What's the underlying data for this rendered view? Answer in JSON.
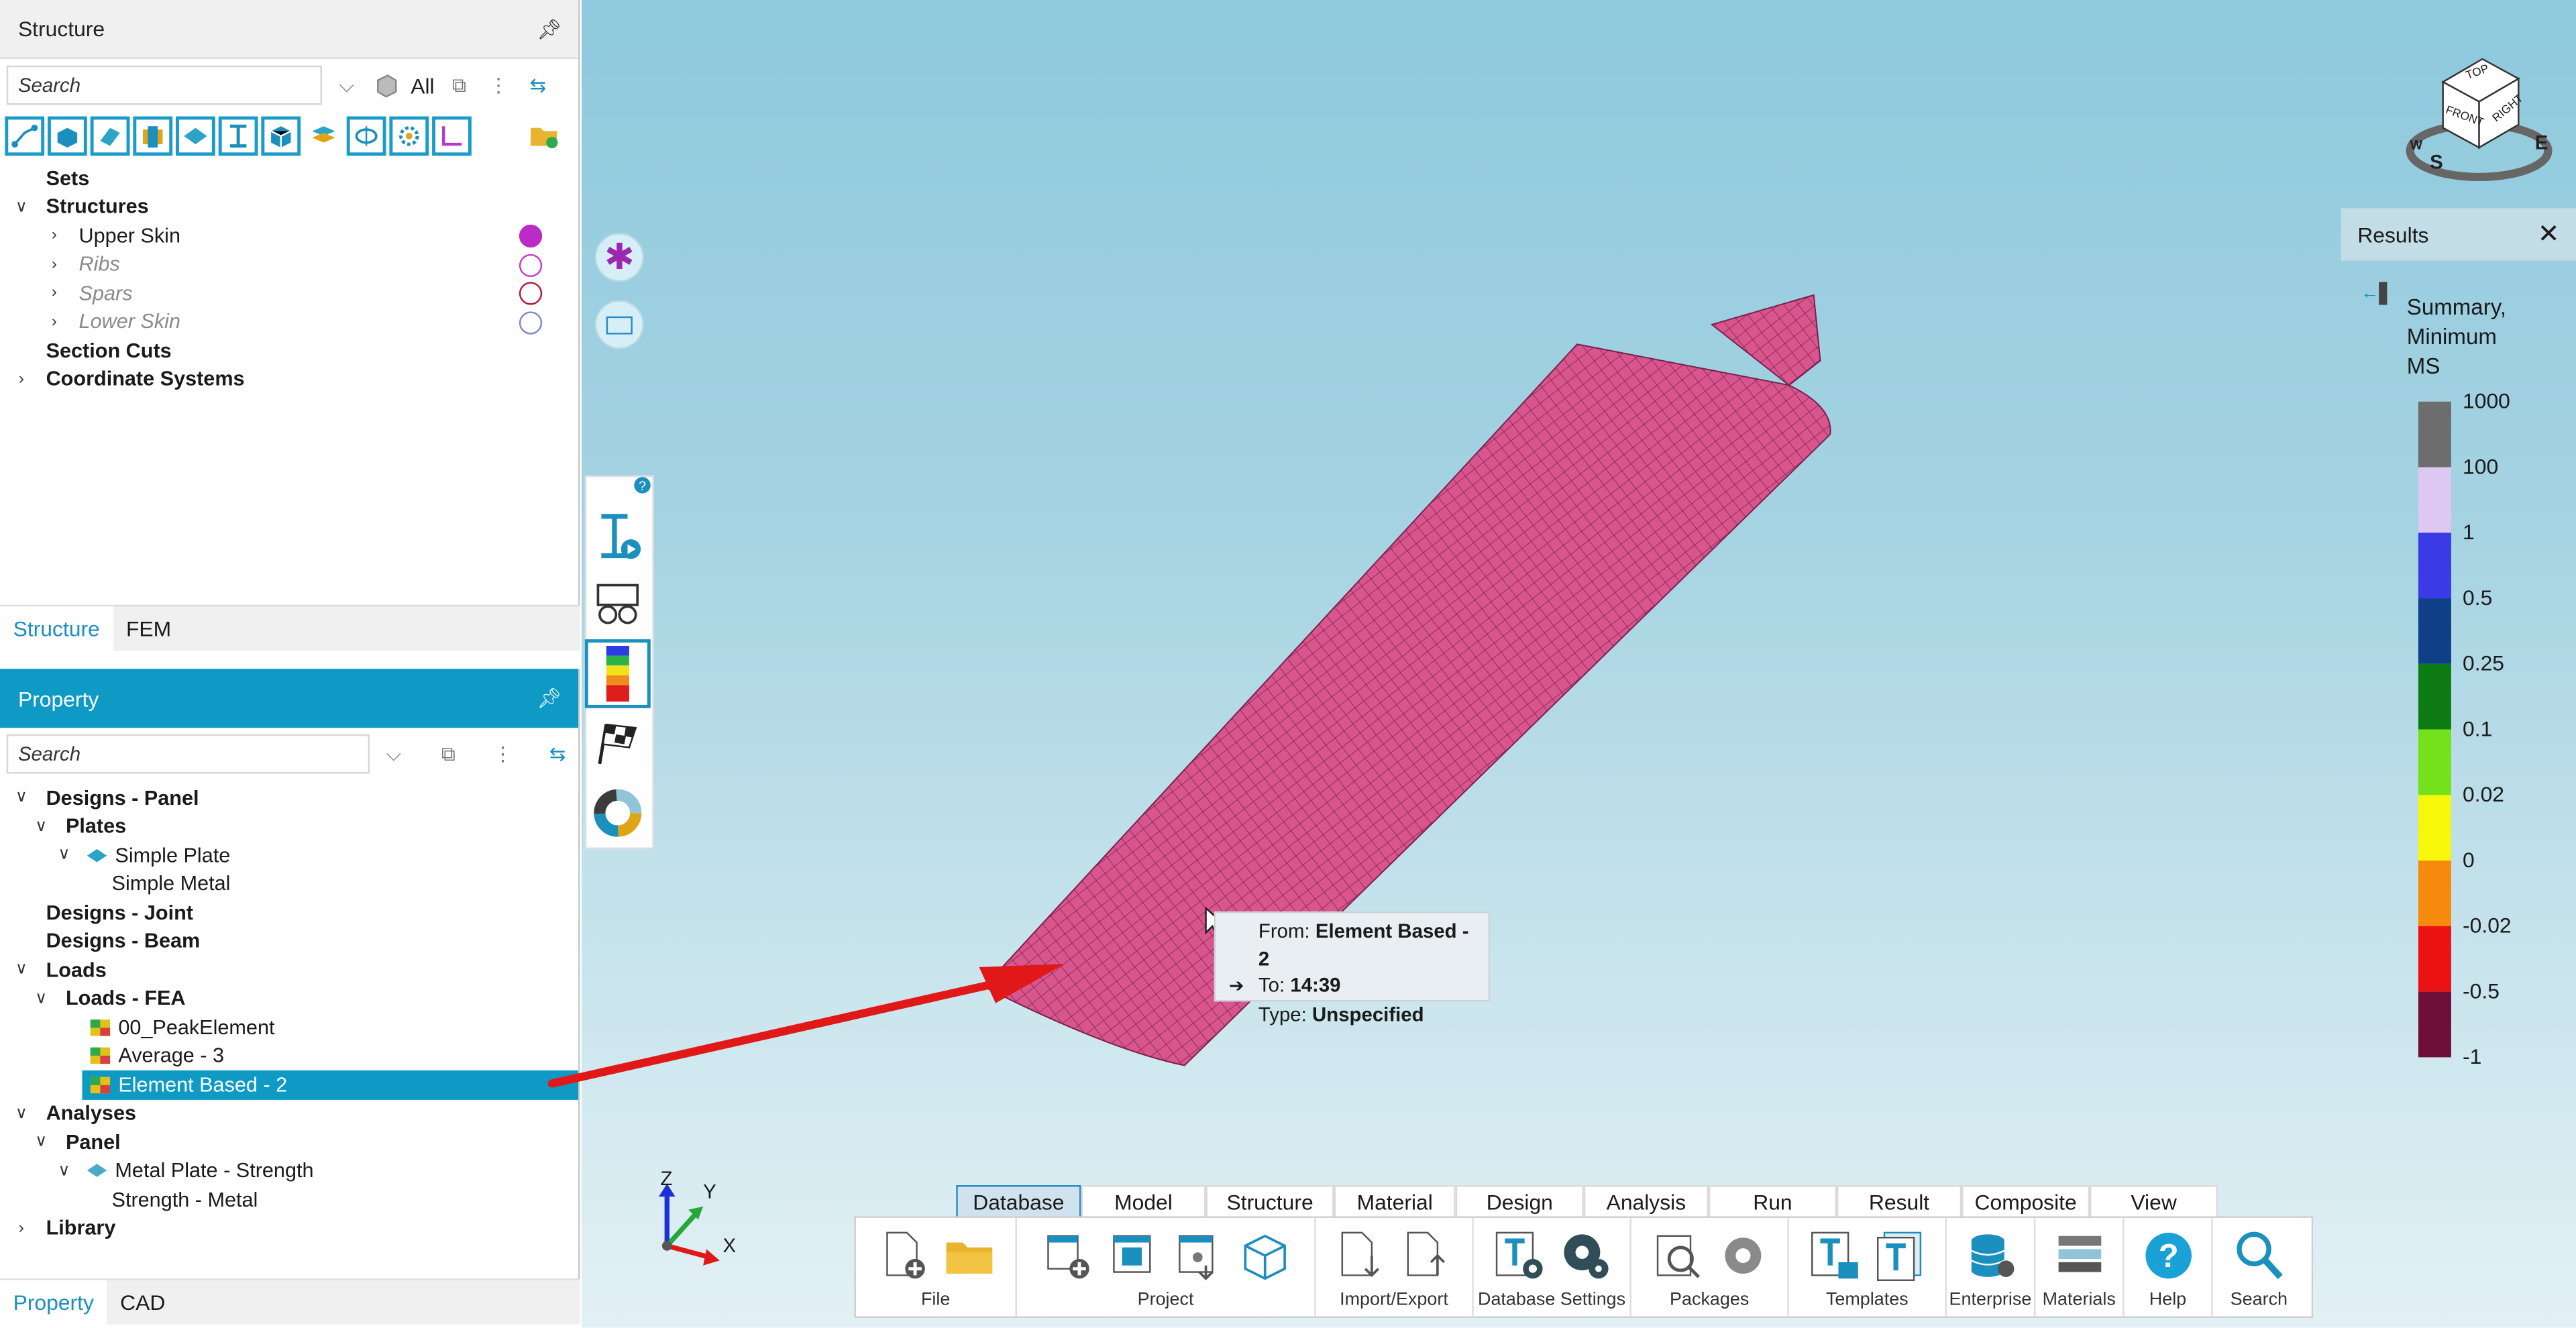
{
  "structure_panel": {
    "title": "Structure",
    "search_placeholder": "Search",
    "filter_all": "All",
    "tree": {
      "sets": "Sets",
      "structures": "Structures",
      "upper_skin": "Upper Skin",
      "ribs": "Ribs",
      "spars": "Spars",
      "lower_skin": "Lower Skin",
      "section_cuts": "Section Cuts",
      "coordinate_systems": "Coordinate Systems"
    },
    "tabs": [
      "Structure",
      "FEM"
    ]
  },
  "property_panel": {
    "title": "Property",
    "search_placeholder": "Search",
    "tree": {
      "designs_panel": "Designs - Panel",
      "plates": "Plates",
      "simple_plate": "Simple Plate",
      "simple_metal": "Simple Metal",
      "designs_joint": "Designs - Joint",
      "designs_beam": "Designs - Beam",
      "loads": "Loads",
      "loads_fea": "Loads - FEA",
      "peak_element": "00_PeakElement",
      "average_3": "Average - 3",
      "element_based_2": "Element Based - 2",
      "analyses": "Analyses",
      "panel": "Panel",
      "metal_plate_strength": "Metal Plate - Strength",
      "strength_metal": "Strength - Metal",
      "library": "Library"
    },
    "tabs": [
      "Property",
      "CAD"
    ]
  },
  "tooltip": {
    "from_label": "From:",
    "from_value": "Element Based - 2",
    "to_label": "To:",
    "to_value": "14:39",
    "type_label": "Type:",
    "type_value": "Unspecified"
  },
  "view_cube": {
    "top": "TOP",
    "front": "FRONT",
    "right": "RIGHT",
    "compass_s": "S",
    "compass_e": "E",
    "compass_w": "W"
  },
  "axes": {
    "x": "X",
    "y": "Y",
    "z": "Z"
  },
  "results": {
    "title": "Results",
    "legend_title_1": "Summary,",
    "legend_title_2": "Minimum",
    "legend_title_3": "MS",
    "labels": [
      "1000",
      "100",
      "1",
      "0.5",
      "0.25",
      "0.1",
      "0.02",
      "0",
      "-0.02",
      "-0.5",
      "-1"
    ],
    "colors": [
      "#6d6d6d",
      "#dcc8f0",
      "#3a3ae6",
      "#0f3f87",
      "#0e7a12",
      "#74e21b",
      "#f7f709",
      "#f58a0c",
      "#ea1212",
      "#6d0f3a"
    ]
  },
  "ribbon": {
    "tabs": [
      "Database",
      "Model",
      "Structure",
      "Material",
      "Design",
      "Analysis",
      "Run",
      "Result",
      "Composite",
      "View"
    ],
    "active_tab": "Database",
    "groups": [
      "File",
      "Project",
      "Import/Export",
      "Database Settings",
      "Packages",
      "Templates",
      "Enterprise",
      "Materials",
      "Help",
      "Search"
    ]
  },
  "colors": {
    "accent": "#0e9ac4",
    "mesh": "#d8558e",
    "arrow": "#e01818",
    "vis_dot": "#bb2bc7"
  }
}
